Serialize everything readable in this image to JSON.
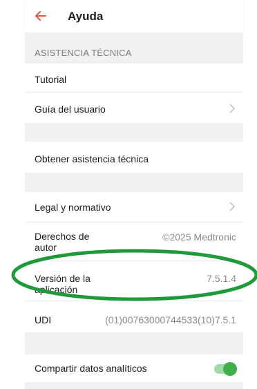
{
  "header": {
    "title": "Ayuda",
    "back_icon": "back-arrow-icon"
  },
  "sections": {
    "support_label": "ASISTENCIA TÉCNICA"
  },
  "rows": {
    "tutorial": "Tutorial",
    "user_guide": "Guía del usuario",
    "get_support": "Obtener asistencia técnica",
    "legal": "Legal y normativo",
    "copyright_label_1": "Derechos de",
    "copyright_label_2": "autor",
    "copyright_value": "©2025 Medtronic",
    "version_label_1": "Versión de la",
    "version_label_2": "aplicación",
    "version_value": "7.5.1.4",
    "udi_label": "UDI",
    "udi_value": "(01)00763000744533(10)7.5.1",
    "analytics": "Compartir datos analíticos",
    "analytics_on": true
  },
  "colors": {
    "accent_back": "#e2543b",
    "toggle_on": "#3fae4b",
    "annotation": "#1f9a3a"
  }
}
